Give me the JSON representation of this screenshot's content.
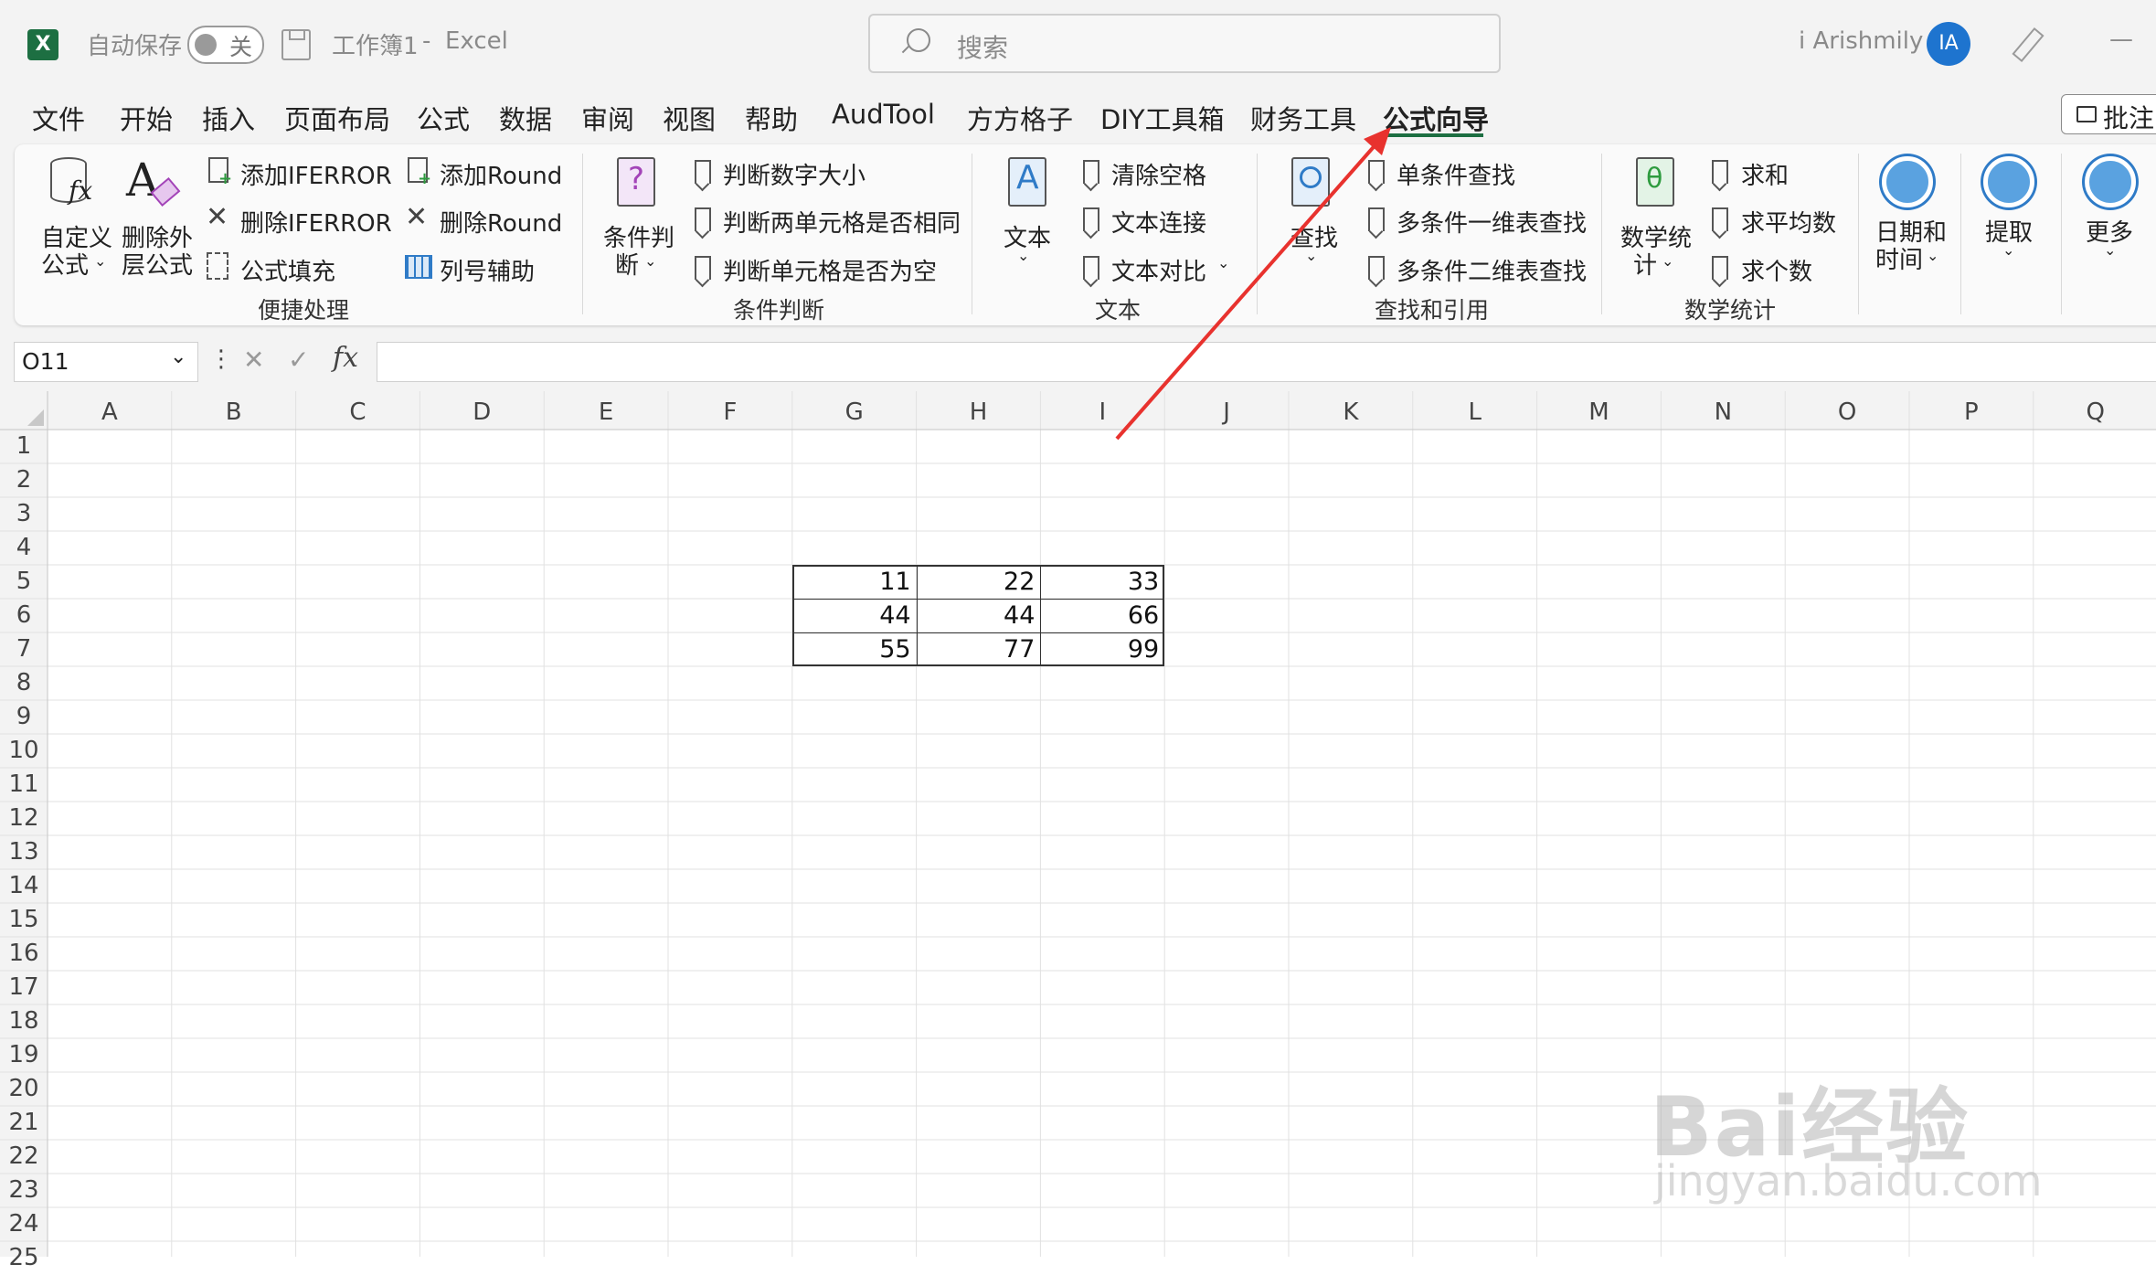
{
  "titlebar": {
    "autosave_label": "自动保存",
    "autosave_state": "关",
    "workbook_name": "工作簿1",
    "separator": "-",
    "app_name": "Excel",
    "search_placeholder": "搜索",
    "user_name": "i Arishmily",
    "avatar_initials": "IA",
    "minimize": "—",
    "app_icon": "excel-logo-icon"
  },
  "menu": {
    "tabs": [
      "文件",
      "开始",
      "插入",
      "页面布局",
      "公式",
      "数据",
      "审阅",
      "视图",
      "帮助",
      "AudTool",
      "方方格子",
      "DIY工具箱",
      "财务工具",
      "公式向导"
    ],
    "active_tab": "公式向导",
    "comment_button": "批注"
  },
  "ribbon": {
    "g1": {
      "custom_formula": [
        "自定义",
        "公式"
      ],
      "delete_outer": [
        "删除外",
        "层公式"
      ],
      "add_iferror": "添加IFERROR",
      "remove_iferror": "删除IFERROR",
      "formula_fill": "公式填充",
      "add_round": "添加Round",
      "remove_round": "删除Round",
      "col_helper": "列号辅助",
      "group_label": "便捷处理"
    },
    "g2": {
      "cond_judge": [
        "条件判",
        "断"
      ],
      "judge_number_size": "判断数字大小",
      "judge_two_cells_same": "判断两单元格是否相同",
      "judge_cell_empty": "判断单元格是否为空",
      "group_label": "条件判断"
    },
    "g3": {
      "text": "文本",
      "clear_spaces": "清除空格",
      "text_concat": "文本连接",
      "text_compare": "文本对比",
      "group_label": "文本"
    },
    "g4": {
      "lookup": "查找",
      "single_cond_lookup": "单条件查找",
      "multi_cond_1d": "多条件一维表查找",
      "multi_cond_2d": "多条件二维表查找",
      "group_label": "查找和引用"
    },
    "g5": {
      "math_stats": [
        "数学统",
        "计"
      ],
      "sum": "求和",
      "average": "求平均数",
      "count": "求个数",
      "group_label": "数学统计"
    },
    "g6": {
      "datetime": [
        "日期和",
        "时间"
      ],
      "extract": "提取",
      "more": "更多"
    }
  },
  "formula_bar": {
    "name_box": "O11",
    "fx": "fx",
    "cancel_symbol": "✕",
    "enter_symbol": "✓",
    "dots": "⋮"
  },
  "sheet": {
    "columns": [
      "A",
      "B",
      "C",
      "D",
      "E",
      "F",
      "G",
      "H",
      "I",
      "J",
      "K",
      "L",
      "M",
      "N",
      "O",
      "P",
      "Q"
    ],
    "rows": [
      "1",
      "2",
      "3",
      "4",
      "5",
      "6",
      "7",
      "8",
      "9",
      "10",
      "11",
      "12",
      "13",
      "14",
      "15",
      "16",
      "17",
      "18",
      "19",
      "20",
      "21",
      "22",
      "23",
      "24",
      "25"
    ],
    "table": [
      [
        "11",
        "22",
        "33"
      ],
      [
        "44",
        "44",
        "66"
      ],
      [
        "55",
        "77",
        "99"
      ]
    ]
  },
  "watermark": {
    "line1": "Bai经验",
    "line2": "jingyan.baidu.com"
  },
  "colors": {
    "excel_green": "#1d6f42",
    "accent_blue": "#2f7bc7",
    "arrow_red": "#e8322e",
    "active_underline": "#1d6f42"
  }
}
